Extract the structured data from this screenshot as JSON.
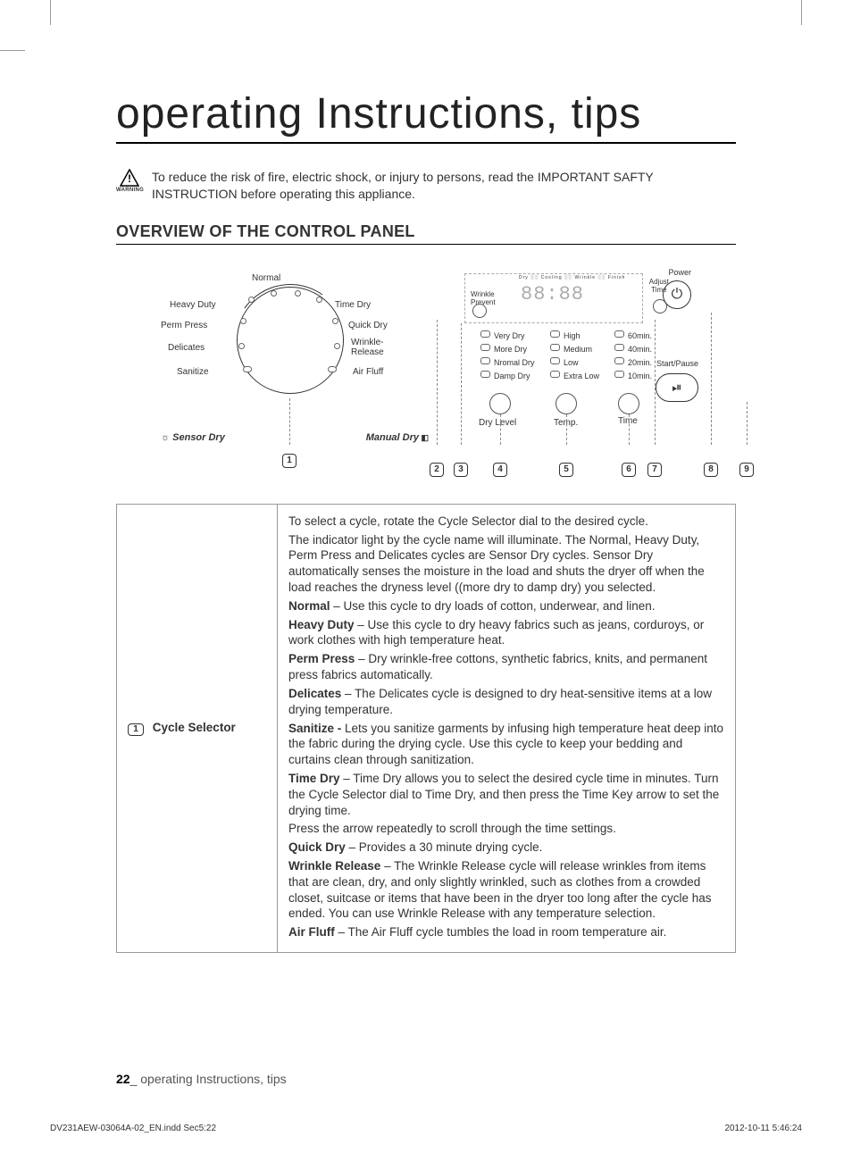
{
  "title": "operating Instructions, tips",
  "warning": {
    "icon_label": "WARNING",
    "text": "To reduce the risk of fire, electric shock, or injury to persons, read the IMPORTANT SAFTY INSTRUCTION before operating this appliance."
  },
  "section_heading": "OVERVIEW OF THE CONTROL PANEL",
  "dial": {
    "sensor_group_label": "Sensor Dry",
    "manual_group_label": "Manual Dry",
    "labels": {
      "heavy_duty": "Heavy Duty",
      "normal": "Normal",
      "time_dry": "Time Dry",
      "perm_press": "Perm Press",
      "quick_dry": "Quick Dry",
      "delicates": "Delicates",
      "wrinkle_release": "Wrinkle-\nRelease",
      "sanitize": "Sanitize",
      "air_fluff": "Air Fluff"
    }
  },
  "display": {
    "wrinkle_prevent": "Wrinkle\nPrevent",
    "adjust_time": "Adjust\nTime",
    "time_readout": "88:88",
    "stages": [
      "Dry",
      "Cooling",
      "Wrinkle Prevent",
      "Finish"
    ]
  },
  "options": {
    "dry_level": {
      "label": "Dry Level",
      "items": [
        "Very Dry",
        "More Dry",
        "Nromal Dry",
        "Damp Dry"
      ]
    },
    "temp": {
      "label": "Temp.",
      "items": [
        "High",
        "Medium",
        "Low",
        "Extra Low"
      ]
    },
    "time": {
      "label": "Time",
      "items": [
        "60min.",
        "40min.",
        "20min.",
        "10min."
      ]
    }
  },
  "buttons": {
    "power": "Power",
    "start_pause": "Start/Pause"
  },
  "callout_numbers": [
    "1",
    "2",
    "3",
    "4",
    "5",
    "6",
    "7",
    "8",
    "9"
  ],
  "table": {
    "row1": {
      "num": "1",
      "title": "Cycle Selector",
      "intro_1": "To select a cycle, rotate the Cycle Selector dial to the desired cycle.",
      "intro_2": "The indicator light by the cycle name will illuminate. The Normal, Heavy Duty, Perm Press and Delicates cycles are Sensor Dry cycles. Sensor Dry automatically senses the moisture in the load and shuts the dryer off when the load reaches the dryness level ((more dry to damp dry) you selected.",
      "normal_b": "Normal",
      "normal_t": " – Use this cycle to dry loads of cotton, underwear, and linen.",
      "heavy_b": "Heavy Duty",
      "heavy_t": " – Use this cycle to dry heavy fabrics such as jeans, corduroys, or work clothes with high temperature heat.",
      "perm_b": "Perm Press",
      "perm_t": " – Dry wrinkle-free cottons, synthetic fabrics, knits, and permanent press fabrics automatically.",
      "delicates_b": "Delicates",
      "delicates_t": " – The Delicates cycle is designed to dry heat-sensitive items at a low drying temperature.",
      "sanitize_b": "Sanitize - ",
      "sanitize_t": "Lets you sanitize garments by infusing high temperature heat deep into the fabric during the drying cycle. Use this cycle to keep your bedding and curtains clean through sanitization.",
      "timedry_b": "Time Dry",
      "timedry_t": " – Time Dry allows you to select the desired cycle time in minutes. Turn the Cycle Selector dial to Time Dry, and then press the Time Key arrow to set the drying time.",
      "timedry_extra": "Press the arrow repeatedly to scroll through the time settings.",
      "quick_b": "Quick Dry",
      "quick_t": " – Provides a 30 minute drying cycle.",
      "wrinkle_b": "Wrinkle Release",
      "wrinkle_t": " – The Wrinkle Release cycle will release wrinkles from items that are clean, dry, and only slightly wrinkled, such as clothes from a crowded closet, suitcase or items that have been in the dryer too long after the cycle has ended. You can use Wrinkle Release with any temperature selection.",
      "airfluff_b": "Air Fluff",
      "airfluff_t": " – The Air Fluff cycle tumbles the load in room temperature air."
    }
  },
  "footer": {
    "page_num": "22",
    "label": "_ operating Instructions, tips"
  },
  "print_meta": {
    "file": "DV231AEW-03064A-02_EN.indd   Sec5:22",
    "datetime": "2012-10-11    5:46:24"
  }
}
